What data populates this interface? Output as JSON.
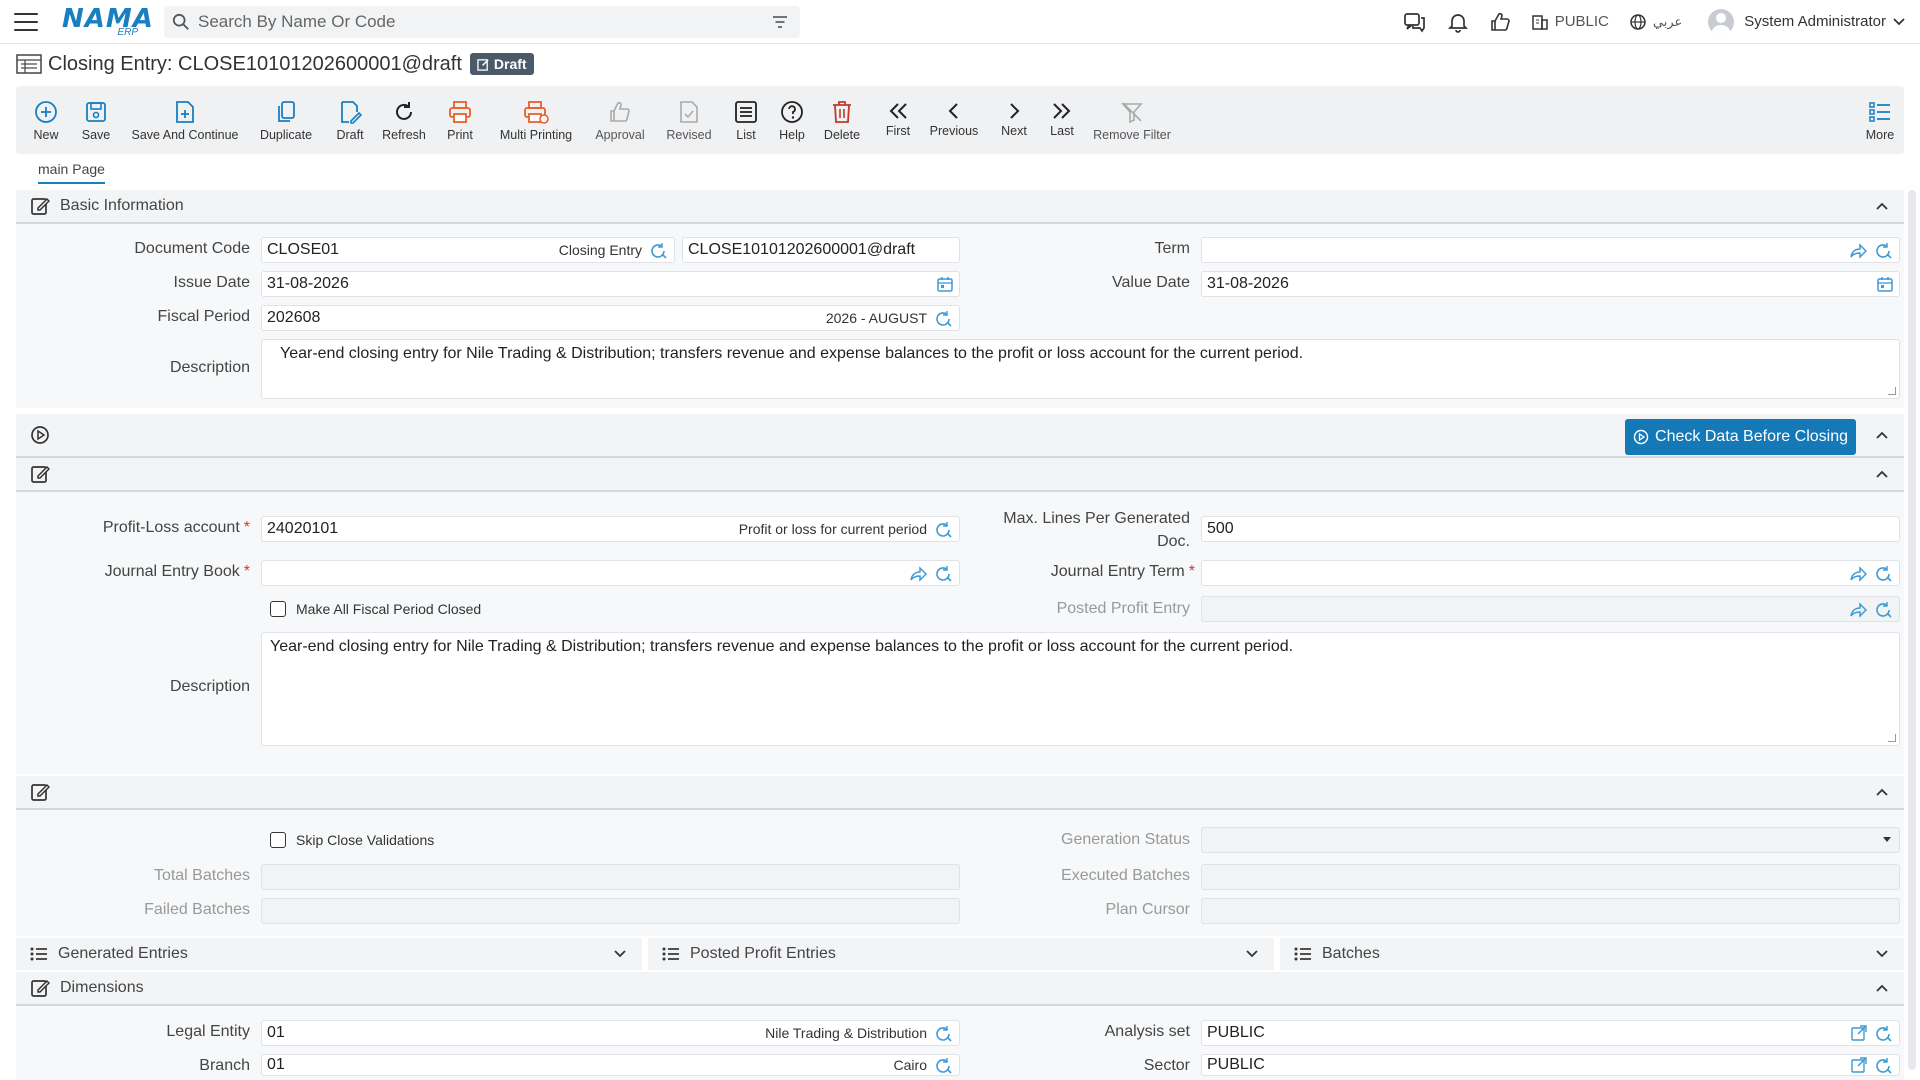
{
  "header": {
    "logo_main": "NAMA",
    "logo_sub": "ERP",
    "search_placeholder": "Search By Name Or Code",
    "org": "PUBLIC",
    "language": "عربي",
    "user": "System Administrator"
  },
  "title": {
    "text": "Closing Entry: CLOSE10101202600001@draft",
    "badge": "Draft"
  },
  "toolbar": {
    "new": "New",
    "save": "Save",
    "save_continue": "Save And Continue",
    "duplicate": "Duplicate",
    "draft": "Draft",
    "refresh": "Refresh",
    "print": "Print",
    "multi_printing": "Multi Printing",
    "approval": "Approval",
    "revised": "Revised",
    "list": "List",
    "help": "Help",
    "delete": "Delete",
    "first": "First",
    "previous": "Previous",
    "next": "Next",
    "last": "Last",
    "remove_filter": "Remove Filter",
    "more": "More"
  },
  "tabs": [
    "main Page"
  ],
  "basic": {
    "title": "Basic Information",
    "document_code_label": "Document Code",
    "document_code": "CLOSE01",
    "document_code_hint": "Closing Entry",
    "document_number": "CLOSE10101202600001@draft",
    "term_label": "Term",
    "issue_date_label": "Issue Date",
    "issue_date": "31-08-2026",
    "value_date_label": "Value Date",
    "value_date": "31-08-2026",
    "fiscal_period_label": "Fiscal Period",
    "fiscal_period": "202608",
    "fiscal_period_hint": "2026 - AUGUST",
    "description_label": "Description",
    "description": "Year-end closing entry for Nile Trading & Distribution; transfers revenue and expense balances to the profit or loss account for the current period."
  },
  "check_button": "Check Data Before Closing",
  "closing": {
    "pl_account_label": "Profit-Loss account",
    "pl_account": "24020101",
    "pl_account_hint": "Profit or loss for current period",
    "max_lines_label_1": "Max. Lines Per Generated",
    "max_lines_label_2": "Doc.",
    "max_lines": "500",
    "journal_book_label": "Journal Entry Book",
    "journal_term_label": "Journal Entry Term",
    "make_closed_label": "Make All Fiscal Period Closed",
    "posted_profit_label": "Posted Profit Entry",
    "description_label": "Description",
    "description": "Year-end closing entry for Nile Trading & Distribution; transfers revenue and expense balances to the profit or loss account for the current period."
  },
  "batch": {
    "skip_label": "Skip Close Validations",
    "generation_status_label": "Generation Status",
    "total_batches_label": "Total Batches",
    "executed_batches_label": "Executed Batches",
    "failed_batches_label": "Failed Batches",
    "plan_cursor_label": "Plan Cursor"
  },
  "collapsibles": [
    "Generated Entries",
    "Posted Profit Entries",
    "Batches"
  ],
  "dimensions": {
    "title": "Dimensions",
    "legal_entity_label": "Legal Entity",
    "legal_entity": "01",
    "legal_entity_hint": "Nile Trading & Distribution",
    "analysis_set_label": "Analysis set",
    "analysis_set": "PUBLIC",
    "branch_label": "Branch",
    "branch": "01",
    "branch_hint": "Cairo",
    "sector_label": "Sector",
    "sector": "PUBLIC"
  },
  "colors": {
    "accent": "#1a7fc1",
    "button": "#1578b7",
    "print": "#e8602c",
    "delete": "#c0392b"
  }
}
